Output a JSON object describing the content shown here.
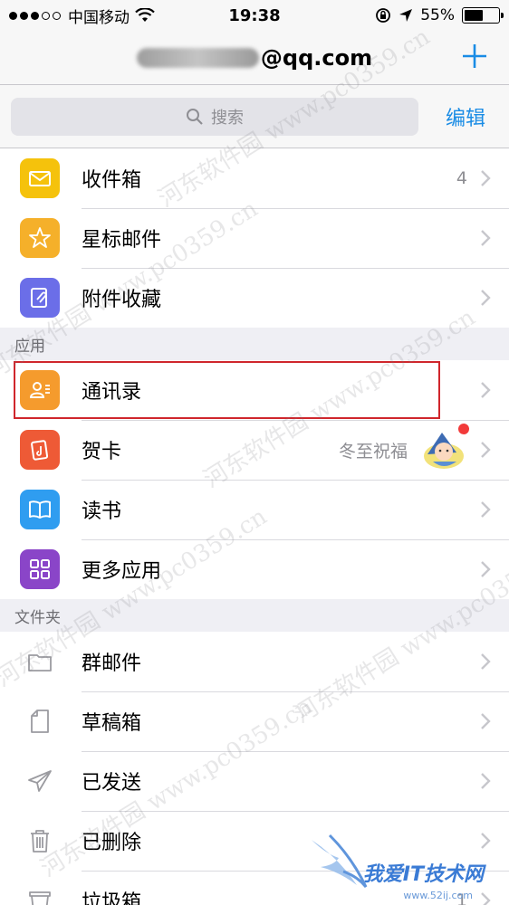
{
  "status": {
    "carrier": "中国移动",
    "time": "19:38",
    "battery": "55%",
    "battery_level": 0.55
  },
  "nav": {
    "account_suffix": "@qq.com"
  },
  "search": {
    "placeholder": "搜索",
    "edit_label": "编辑"
  },
  "mailboxes": [
    {
      "label": "收件箱",
      "badge": "4",
      "icon": "inbox-icon",
      "color": "#f5c20c"
    },
    {
      "label": "星标邮件",
      "badge": "",
      "icon": "star-icon",
      "color": "#f5b02a"
    },
    {
      "label": "附件收藏",
      "badge": "",
      "icon": "attachment-icon",
      "color": "#6b6ee8"
    }
  ],
  "apps_header": "应用",
  "apps": [
    {
      "label": "通讯录",
      "icon": "contacts-icon",
      "color": "#f59b2d"
    },
    {
      "label": "贺卡",
      "extra": "冬至祝福",
      "icon": "card-icon",
      "color": "#ee5a36"
    },
    {
      "label": "读书",
      "icon": "book-icon",
      "color": "#2f9df0"
    },
    {
      "label": "更多应用",
      "icon": "grid-icon",
      "color": "#8a45c8"
    }
  ],
  "folders_header": "文件夹",
  "folders": [
    {
      "label": "群邮件",
      "badge": "",
      "icon": "folder-icon"
    },
    {
      "label": "草稿箱",
      "badge": "",
      "icon": "draft-icon"
    },
    {
      "label": "已发送",
      "badge": "",
      "icon": "sent-icon"
    },
    {
      "label": "已删除",
      "badge": "",
      "icon": "trash-icon"
    },
    {
      "label": "垃圾箱",
      "badge": "1",
      "icon": "spam-icon"
    }
  ],
  "watermark": "河东软件园 www.pc0359.cn",
  "logo": {
    "text": "我爱IT技术网",
    "sub": "www.52ij.com"
  }
}
